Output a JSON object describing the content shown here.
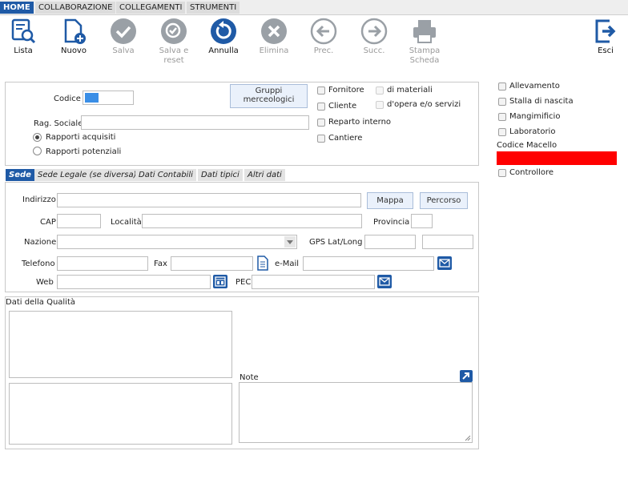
{
  "top_tabs": [
    "HOME",
    "COLLABORAZIONE",
    "COLLEGAMENTI",
    "STRUMENTI"
  ],
  "toolbar": {
    "lista": "Lista",
    "nuovo": "Nuovo",
    "salva": "Salva",
    "salva_reset_1": "Salva e",
    "salva_reset_2": "reset",
    "annulla": "Annulla",
    "elimina": "Elimina",
    "prec": "Prec.",
    "succ": "Succ.",
    "stampa_1": "Stampa",
    "stampa_2": "Scheda",
    "esci": "Esci"
  },
  "header_form": {
    "codice_label": "Codice",
    "gruppi_1": "Gruppi",
    "gruppi_2": "merceologici",
    "rag_sociale_label": "Rag. Sociale",
    "rapporti_acquisiti": "Rapporti acquisiti",
    "rapporti_potenziali": "Rapporti potenziali",
    "fornitore": "Fornitore",
    "di_materiali": "di materiali",
    "cliente": "Cliente",
    "d_opera": "d'opera e/o servizi",
    "reparto_interno": "Reparto interno",
    "cantiere": "Cantiere"
  },
  "right_options": {
    "allevamento": "Allevamento",
    "stalla": "Stalla di nascita",
    "mangimificio": "Mangimificio",
    "laboratorio": "Laboratorio",
    "codice_macello": "Codice Macello",
    "controllore": "Controllore"
  },
  "sub_tabs": [
    "Sede",
    "Sede Legale (se diversa)",
    "Dati Contabili",
    "Dati tipici",
    "Altri dati"
  ],
  "sede": {
    "indirizzo": "Indirizzo",
    "mappa": "Mappa",
    "percorso": "Percorso",
    "cap": "CAP",
    "localita": "Località",
    "provincia": "Provincia",
    "nazione": "Nazione",
    "gps": "GPS Lat/Long",
    "telefono": "Telefono",
    "fax": "Fax",
    "email": "e-Mail",
    "web": "Web",
    "pec": "PEC"
  },
  "qualita": {
    "title": "Dati della Qualità",
    "note": "Note"
  },
  "colors": {
    "accent": "#1f5aa6",
    "codice_macello_field": "#ff0000",
    "codice_swatch": "#3a8ee6"
  }
}
